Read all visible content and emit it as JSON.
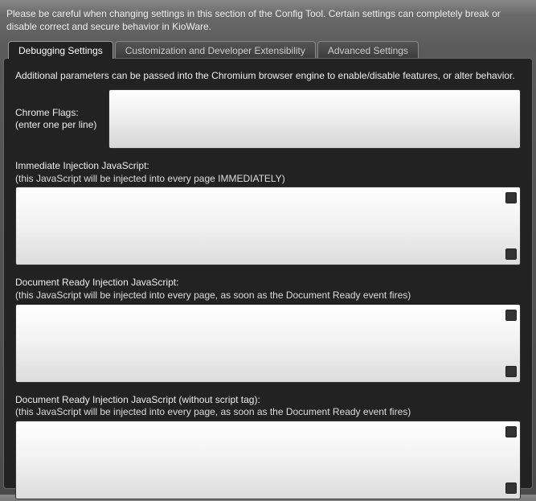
{
  "warning": "Please be careful when changing settings in this section of the Config Tool. Certain settings can completely break or disable correct and secure behavior in KioWare.",
  "tabs": {
    "debugging": "Debugging Settings",
    "customization": "Customization and Developer Extensibility",
    "advanced": "Advanced Settings"
  },
  "panel": {
    "intro": "Additional parameters can be passed into the Chromium browser engine to enable/disable features, or alter behavior.",
    "chromeFlagsLabel": "Chrome Flags: (enter one per line)",
    "chromeFlagsValue": "",
    "immediate": {
      "title": "Immediate Injection JavaScript:",
      "sub": "(this JavaScript will be injected into every page IMMEDIATELY)",
      "value": ""
    },
    "docReady": {
      "title": "Document Ready Injection JavaScript:",
      "sub": "(this JavaScript will be injected into every page, as soon as the Document Ready event fires)",
      "value": ""
    },
    "docReadyNoTag": {
      "title": "Document Ready Injection JavaScript (without script tag):",
      "sub": "(this JavaScript will be injected into every page, as soon as the Document Ready event fires)",
      "value": ""
    }
  }
}
